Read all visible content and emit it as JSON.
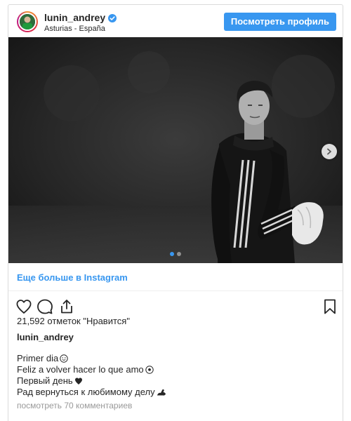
{
  "header": {
    "username": "lunin_andrey",
    "location": "Asturias - España",
    "view_profile_label": "Посмотреть профиль",
    "accent_color": "#3897f0"
  },
  "photo": {
    "carousel_slides": 2,
    "active_slide": 1
  },
  "more_link": "Еще больше в Instagram",
  "likes_text": "21,592 отметок \"Нравится\"",
  "caption": {
    "username": "lunin_andrey",
    "lines": [
      {
        "text": "Primer dia",
        "emoji": "smiling-face-icon"
      },
      {
        "text": "Feliz a volver hacer lo que amo",
        "emoji": "soccer-ball-icon"
      },
      {
        "text": "Первый день",
        "emoji": "black-heart-icon"
      },
      {
        "text": "Рад вернуться к любимому делу",
        "emoji": "flexed-arm-icon"
      }
    ]
  },
  "comments_link": "посмотреть 70 комментариев",
  "icons": [
    "heart-icon",
    "comment-icon",
    "share-icon",
    "bookmark-icon",
    "verified-icon",
    "chevron-right-icon"
  ]
}
